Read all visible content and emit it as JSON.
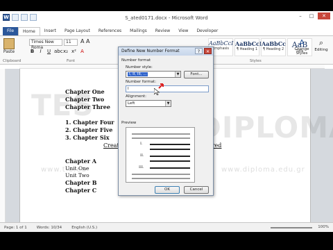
{
  "window": {
    "title": "S_ated0171.docx - Microsoft Word",
    "minimize": "–",
    "maximize": "□",
    "close": "✕"
  },
  "ribbon_tabs": [
    "File",
    "Home",
    "Insert",
    "Page Layout",
    "References",
    "Mailings",
    "Review",
    "View",
    "Developer"
  ],
  "ribbon": {
    "paste_label": "Paste",
    "clipboard_label": "Clipboard",
    "font_name": "Times New Roma",
    "font_size": "11",
    "font_group_label": "Font",
    "styles_group_label": "Styles",
    "styles": [
      {
        "preview": "AaBbCcI",
        "name": "Emphasis"
      },
      {
        "preview": "AaBbCcI",
        "name": "¶ Heading 1"
      },
      {
        "preview": "AaBbCc",
        "name": "¶ Heading 2"
      },
      {
        "preview": "AaB",
        "name": "Title"
      }
    ],
    "change_styles": "Change Styles",
    "editing": "Editing"
  },
  "document": {
    "lines_top": [
      "Chapter One",
      "Chapter Two",
      "Chapter Three"
    ],
    "numbered": [
      "1.  Chapter Four",
      "2.  Chapter Five",
      "3.  Chapter Six"
    ],
    "create_left": "Create",
    "create_right": "ered",
    "lines_bottom": [
      {
        "text": "Chapter A",
        "bold": true
      },
      {
        "text": "Unit One",
        "bold": false
      },
      {
        "text": "Unit Two",
        "bold": false
      },
      {
        "text": "Chapter B",
        "bold": true
      },
      {
        "text": "Chapter C",
        "bold": true
      }
    ]
  },
  "watermark": {
    "brand_left": "TES",
    "brand_right": "DIPLOMA",
    "url_left": "www.t e.eu",
    "url_right": "www.diploma.edu.gr"
  },
  "dialog": {
    "title": "Define New Number Format",
    "help": "?",
    "close": "✕",
    "section_number_format": "Number format",
    "number_style_label": "Number style:",
    "number_style_value": "I, II, III, ...",
    "font_button": "Font...",
    "number_format_label": "Number format:",
    "number_format_value": "I",
    "alignment_label": "Alignment:",
    "alignment_value": "Left",
    "preview_label": "Preview",
    "preview_numbers": [
      "I.",
      "II.",
      "III."
    ],
    "ok": "OK",
    "cancel": "Cancel"
  },
  "status_bar": {
    "page": "Page: 1 of 1",
    "words": "Words: 10/34",
    "language": "English (U.S.)",
    "zoom": "100%"
  }
}
